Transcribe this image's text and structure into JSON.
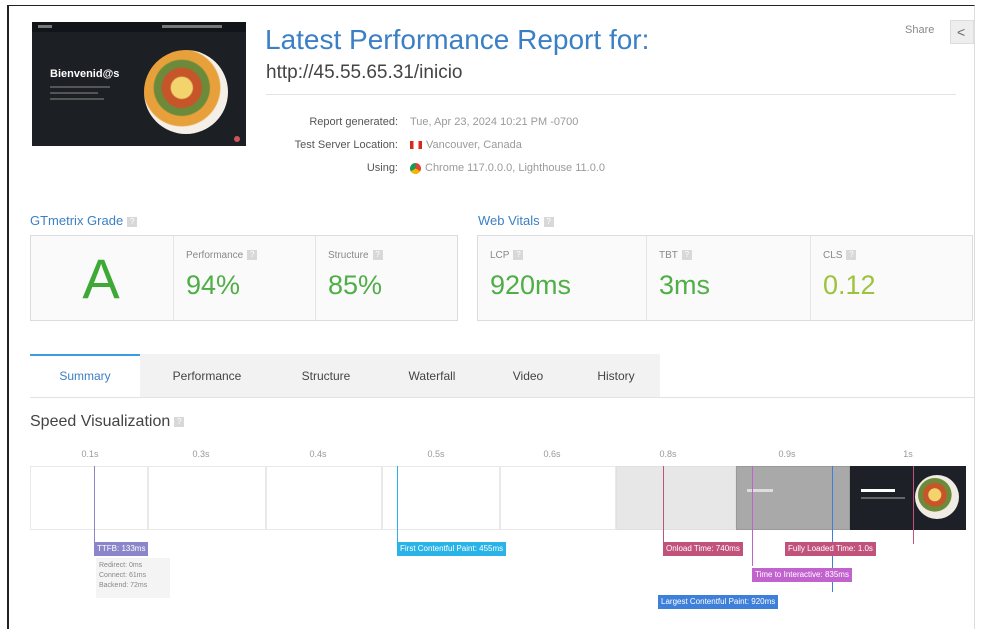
{
  "header": {
    "title": "Latest Performance Report for:",
    "url": "http://45.55.65.31/inicio",
    "thumbnail_heading": "Bienvenid@s",
    "share_label": "Share",
    "meta": [
      {
        "key": "Report generated:",
        "value": "Tue, Apr 23, 2024 10:21 PM -0700",
        "icon": ""
      },
      {
        "key": "Test Server Location:",
        "value": "Vancouver, Canada",
        "icon": "flag-canada-icon"
      },
      {
        "key": "Using:",
        "value": "Chrome 117.0.0.0, Lighthouse 11.0.0",
        "icon": "chrome-icon"
      }
    ]
  },
  "grade": {
    "title": "GTmetrix Grade",
    "letter": "A",
    "performance_label": "Performance",
    "performance_value": "94%",
    "structure_label": "Structure",
    "structure_value": "85%"
  },
  "vitals": {
    "title": "Web Vitals",
    "lcp_label": "LCP",
    "lcp_value": "920ms",
    "tbt_label": "TBT",
    "tbt_value": "3ms",
    "cls_label": "CLS",
    "cls_value": "0.12"
  },
  "tabs": [
    "Summary",
    "Performance",
    "Structure",
    "Waterfall",
    "Video",
    "History"
  ],
  "active_tab": "Summary",
  "speed": {
    "title": "Speed Visualization",
    "ticks": [
      "0.1s",
      "0.3s",
      "0.4s",
      "0.5s",
      "0.6s",
      "0.8s",
      "0.9s",
      "1s"
    ],
    "markers": {
      "ttfb": "TTFB: 133ms",
      "ttfb_details": [
        "Redirect: 0ms",
        "Connect: 61ms",
        "Backend: 72ms"
      ],
      "fcp": "First Contentful Paint: 455ms",
      "onload": "Onload Time: 740ms",
      "fully_loaded": "Fully Loaded Time: 1.0s",
      "tti": "Time to Interactive: 835ms",
      "lcp": "Largest Contentful Paint: 920ms"
    }
  },
  "colors": {
    "accent": "#3b7fc4",
    "grade_green": "#3ea936",
    "value_green": "#4fae46",
    "cls_green": "#9dc23b",
    "ttfb": "#8a86c9",
    "fcp": "#29b3e6",
    "onload": "#c0527b",
    "tti": "#c262cf",
    "lcp": "#3e7fd9"
  }
}
